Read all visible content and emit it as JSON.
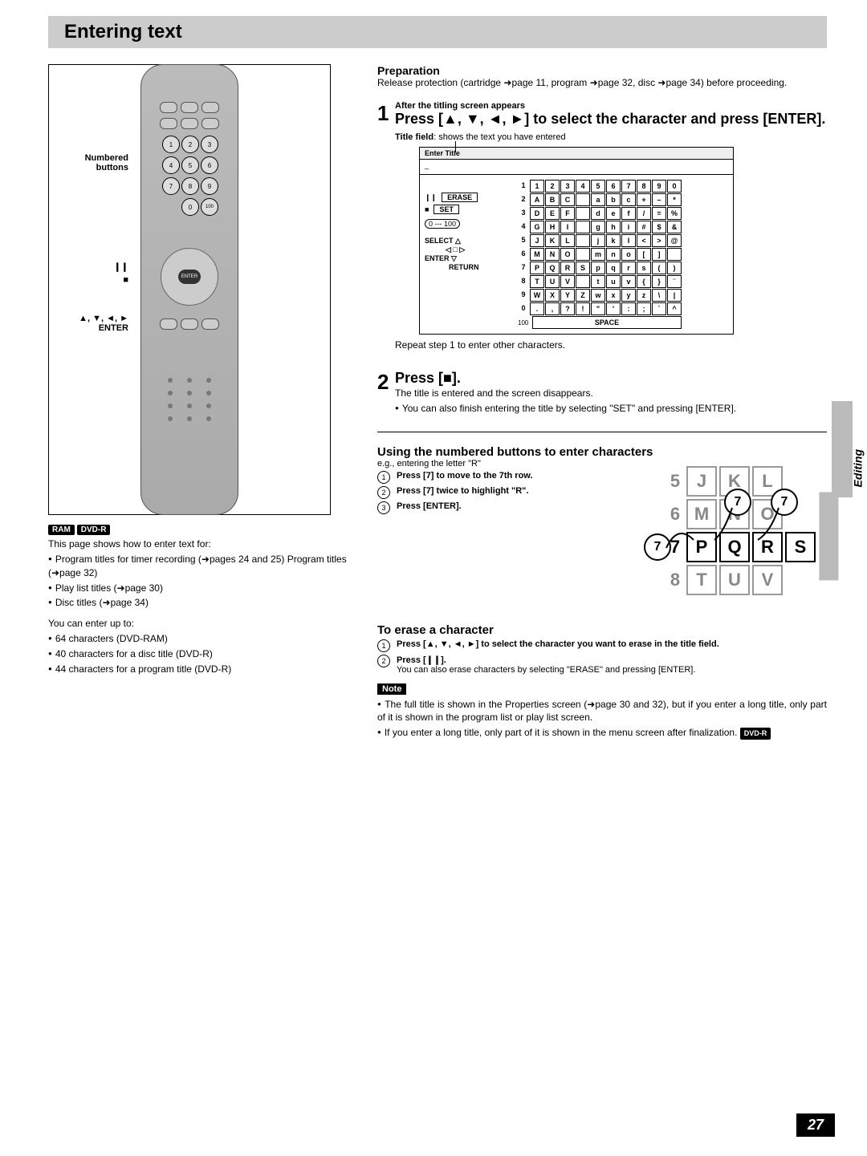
{
  "page_title": "Entering text",
  "page_number": "27",
  "side_tab": "Editing",
  "remote_callouts": {
    "numbered": "Numbered\nbuttons",
    "pause": "❙❙",
    "stop": "■",
    "dpad": "▲, ▼, ◄, ►\nENTER"
  },
  "remote_buttons": {
    "numbers": [
      "1",
      "2",
      "3",
      "4",
      "5",
      "6",
      "7",
      "8",
      "9",
      "0",
      "100"
    ],
    "enter": "ENTER"
  },
  "badges": {
    "ram": "RAM",
    "dvdr": "DVD-R"
  },
  "left_text": {
    "intro": "This page shows how to enter text for:",
    "bullets": [
      "Program titles for timer recording (➜pages 24 and 25) Program titles (➜page 32)",
      "Play list titles (➜page 30)",
      "Disc titles (➜page 34)"
    ],
    "limits_intro": "You can enter up to:",
    "limits": [
      "64 characters (DVD-RAM)",
      "40 characters for a disc title (DVD-R)",
      "44 characters for a program title (DVD-R)"
    ]
  },
  "prep": {
    "heading": "Preparation",
    "text": "Release protection (cartridge ➜page 11, program ➜page 32, disc ➜page 34) before proceeding."
  },
  "step1": {
    "sub": "After the titling screen appears",
    "main": "Press [▲, ▼, ◄, ►] to select the character and press [ENTER].",
    "title_field_label": "Title field",
    "title_field_text": ": shows the text you have entered",
    "repeat": "Repeat step 1 to enter other characters."
  },
  "screen": {
    "header": "Enter Title",
    "erase": "ERASE",
    "set": "SET",
    "range": "0 --- 100",
    "select": "SELECT",
    "enter": "ENTER",
    "return": "RETURN",
    "space_label": "100",
    "space": "SPACE",
    "rows": [
      {
        "n": "1",
        "cells": [
          "1",
          "2",
          "3",
          "4",
          "5",
          "6",
          "7",
          "8",
          "9",
          "0"
        ]
      },
      {
        "n": "2",
        "cells": [
          "A",
          "B",
          "C",
          "",
          "a",
          "b",
          "c",
          "+",
          "–",
          "*"
        ]
      },
      {
        "n": "3",
        "cells": [
          "D",
          "E",
          "F",
          "",
          "d",
          "e",
          "f",
          "/",
          "=",
          "%"
        ]
      },
      {
        "n": "4",
        "cells": [
          "G",
          "H",
          "I",
          "",
          "g",
          "h",
          "i",
          "#",
          "$",
          "&"
        ]
      },
      {
        "n": "5",
        "cells": [
          "J",
          "K",
          "L",
          "",
          "j",
          "k",
          "l",
          "<",
          ">",
          "@"
        ]
      },
      {
        "n": "6",
        "cells": [
          "M",
          "N",
          "O",
          "",
          "m",
          "n",
          "o",
          "[",
          "]",
          ""
        ]
      },
      {
        "n": "7",
        "cells": [
          "P",
          "Q",
          "R",
          "S",
          "p",
          "q",
          "r",
          "s",
          "(",
          ")"
        ]
      },
      {
        "n": "8",
        "cells": [
          "T",
          "U",
          "V",
          "",
          "t",
          "u",
          "v",
          "{",
          "}",
          "¨"
        ]
      },
      {
        "n": "9",
        "cells": [
          "W",
          "X",
          "Y",
          "Z",
          "w",
          "x",
          "y",
          "z",
          "\\",
          "|"
        ]
      },
      {
        "n": "0",
        "cells": [
          ".",
          ",",
          "?",
          "!",
          "\"",
          "'",
          ":",
          ";",
          "`",
          "^"
        ]
      }
    ]
  },
  "step2": {
    "main": "Press [■].",
    "line1": "The title is entered and the screen disappears.",
    "line2": "You can also finish entering the title by selecting \"SET\" and pressing [ENTER]."
  },
  "using": {
    "heading": "Using the numbered buttons to enter characters",
    "eg": "e.g., entering the letter \"R\"",
    "s1": "Press [7] to move to the 7th row.",
    "s2": "Press [7] twice to highlight \"R\".",
    "s3": "Press [ENTER].",
    "figure": {
      "rows": [
        {
          "n": "5",
          "cells": [
            "J",
            "K",
            "L",
            ""
          ]
        },
        {
          "n": "6",
          "cells": [
            "M",
            "N",
            "O",
            ""
          ]
        },
        {
          "n": "7",
          "cells": [
            "P",
            "Q",
            "R",
            "S"
          ]
        },
        {
          "n": "8",
          "cells": [
            "T",
            "U",
            "V",
            ""
          ]
        }
      ],
      "circles": [
        "7",
        "7",
        "7"
      ]
    }
  },
  "erase": {
    "heading": "To erase a character",
    "s1": "Press [▲, ▼, ◄, ►] to select the character you want to erase in the title field.",
    "s2a": "Press [❙❙].",
    "s2b": "You can also erase characters by selecting \"ERASE\" and pressing [ENTER]."
  },
  "note": {
    "label": "Note",
    "b1": "The full title is shown in the Properties screen (➜page 30 and 32), but if you enter a long title, only part of it is shown in the program list or play list screen.",
    "b2a": "If you enter a long title, only part of it is shown in the menu screen after finalization.",
    "b2_badge": "DVD-R"
  }
}
